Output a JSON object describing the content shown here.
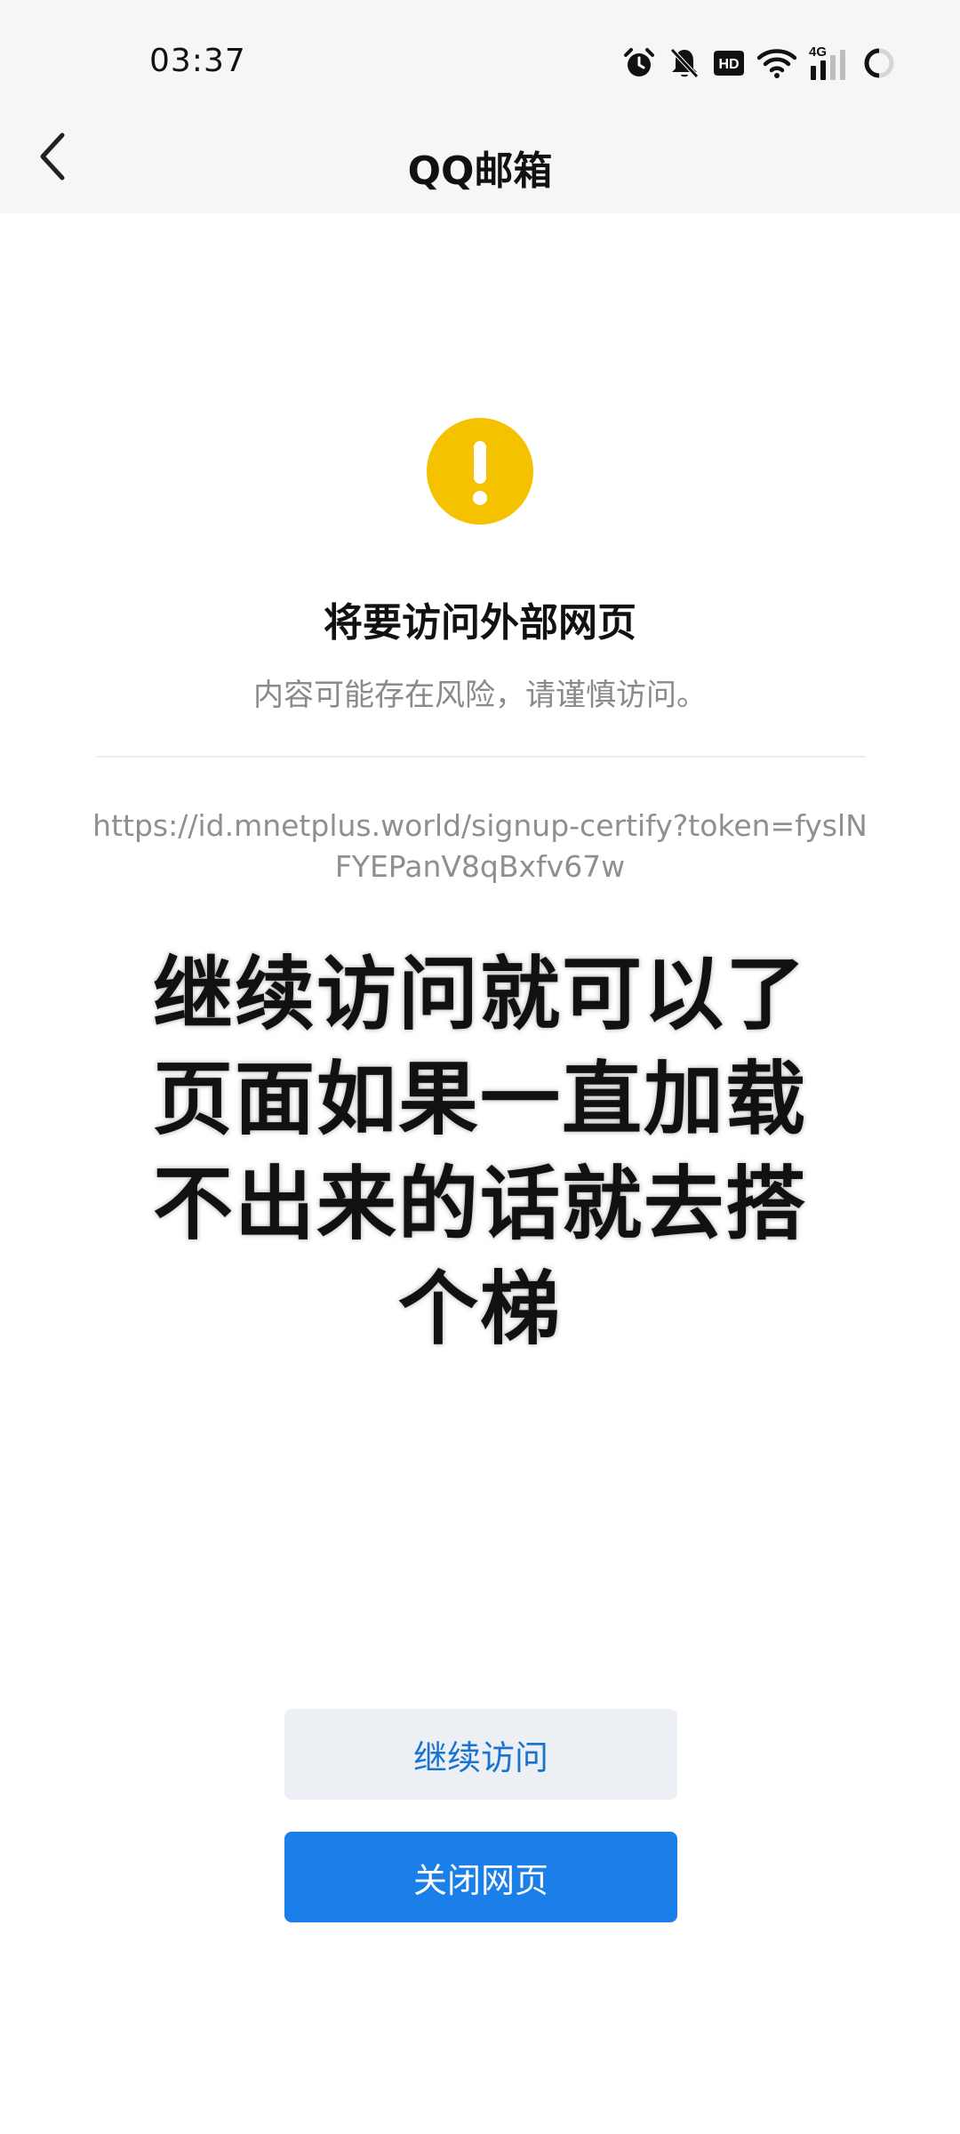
{
  "status_bar": {
    "time": "03:37",
    "network": "4G",
    "icons": [
      "alarm-icon",
      "bell-muted-icon",
      "hd-icon",
      "wifi-icon",
      "signal-icon",
      "battery-loading-icon"
    ]
  },
  "nav": {
    "title": "QQ邮箱",
    "back_icon": "chevron-left-icon"
  },
  "warning": {
    "icon": "exclamation-icon",
    "icon_color": "#f5c200",
    "title": "将要访问外部网页",
    "subtitle": "内容可能存在风险，请谨慎访问。",
    "url": "https://id.mnetplus.world/signup-certify?token=fyslNFYEPanV8qBxfv67w"
  },
  "overlay": {
    "lines": [
      "继续访问就可以了",
      "页面如果一直加载",
      "不出来的话就去搭",
      "个梯"
    ]
  },
  "buttons": {
    "continue_label": "继续访问",
    "close_label": "关闭网页",
    "close_color": "#1a7fe8",
    "continue_text_color": "#1b73d1"
  }
}
